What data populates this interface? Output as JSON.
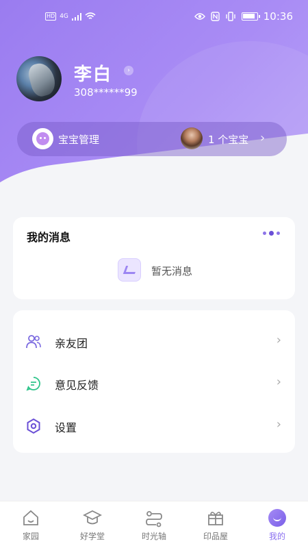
{
  "status_bar": {
    "network_hd": "HD",
    "network_gen": "4G",
    "time": "10:36"
  },
  "profile": {
    "name": "李白",
    "id_masked": "308******99"
  },
  "baby_bar": {
    "label": "宝宝管理",
    "count": "1 个宝宝"
  },
  "messages": {
    "title": "我的消息",
    "empty_text": "暂无消息"
  },
  "menu": {
    "items": [
      {
        "label": "亲友团",
        "icon": "family-icon"
      },
      {
        "label": "意见反馈",
        "icon": "feedback-icon"
      },
      {
        "label": "设置",
        "icon": "settings-icon"
      }
    ]
  },
  "tabs": [
    {
      "label": "家园",
      "icon": "home-icon"
    },
    {
      "label": "好学堂",
      "icon": "graduation-cap-icon"
    },
    {
      "label": "时光轴",
      "icon": "timeline-icon"
    },
    {
      "label": "印品屋",
      "icon": "gift-icon"
    },
    {
      "label": "我的",
      "icon": "profile-icon",
      "active": true
    }
  ],
  "colors": {
    "accent": "#8a6ff0",
    "header_gradient_start": "#9a7cf0",
    "header_gradient_end": "#b9a4f7",
    "background": "#f4f5f8",
    "feedback_green": "#2ec48a"
  }
}
